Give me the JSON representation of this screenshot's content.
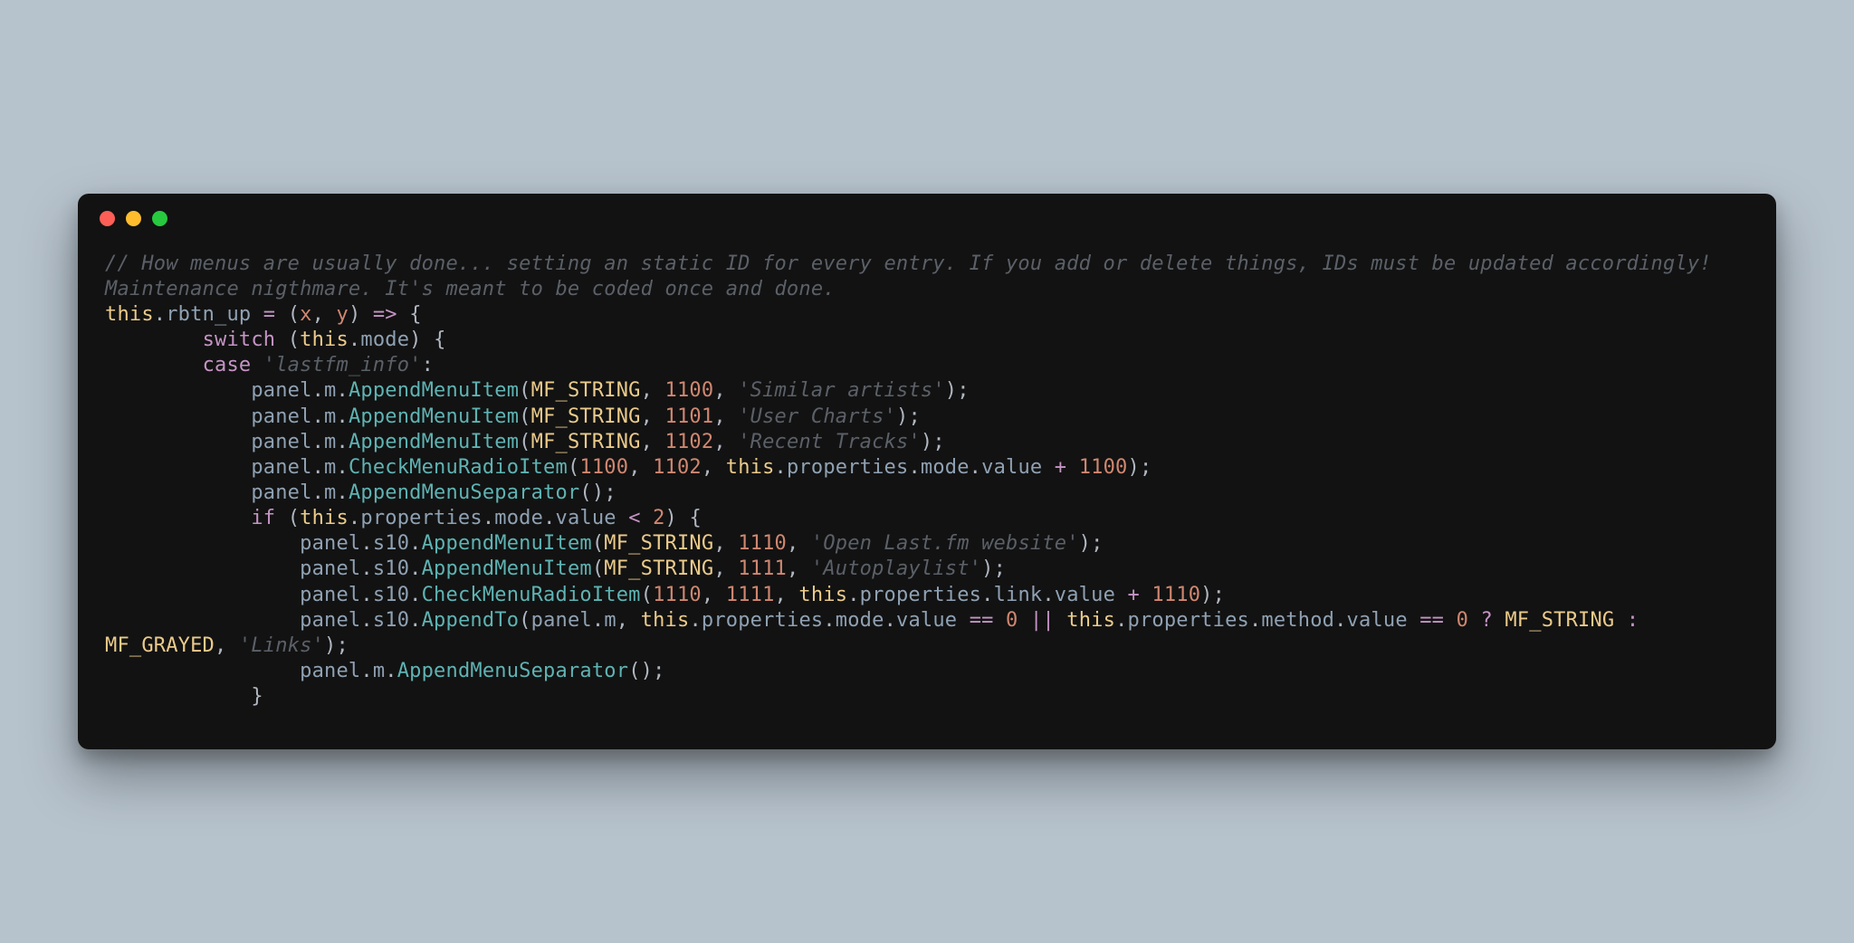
{
  "window": {
    "traffic": {
      "red": "close",
      "yellow": "minimize",
      "green": "zoom"
    }
  },
  "code": {
    "comment": "// How menus are usually done... setting an static ID for every entry. If you add or delete things, IDs must be updated accordingly! Maintenance nigthmare. It's meant to be coded once and done.",
    "l2": {
      "this": "this",
      "dot1": ".",
      "rbtn": "rbtn_up",
      "eq": " = ",
      "lp": "(",
      "x": "x",
      "c": ", ",
      "y": "y",
      "rp": ")",
      "arrow": " => ",
      "lb": "{"
    },
    "l3": {
      "ind": "        ",
      "switch": "switch",
      "sp": " ",
      "lp": "(",
      "this": "this",
      "dot": ".",
      "mode": "mode",
      "rp": ")",
      "sp2": " ",
      "lb": "{"
    },
    "l4": {
      "ind": "        ",
      "case": "case",
      "sp": " ",
      "str": "'lastfm_info'",
      "colon": ":"
    },
    "l5": {
      "ind": "            ",
      "panel": "panel",
      "d1": ".",
      "m": "m",
      "d2": ".",
      "fn": "AppendMenuItem",
      "lp": "(",
      "mf": "MF_STRING",
      "c1": ", ",
      "n": "1100",
      "c2": ", ",
      "s": "'Similar artists'",
      "rp": ")",
      "sc": ";"
    },
    "l6": {
      "ind": "            ",
      "panel": "panel",
      "d1": ".",
      "m": "m",
      "d2": ".",
      "fn": "AppendMenuItem",
      "lp": "(",
      "mf": "MF_STRING",
      "c1": ", ",
      "n": "1101",
      "c2": ", ",
      "s": "'User Charts'",
      "rp": ")",
      "sc": ";"
    },
    "l7": {
      "ind": "            ",
      "panel": "panel",
      "d1": ".",
      "m": "m",
      "d2": ".",
      "fn": "AppendMenuItem",
      "lp": "(",
      "mf": "MF_STRING",
      "c1": ", ",
      "n": "1102",
      "c2": ", ",
      "s": "'Recent Tracks'",
      "rp": ")",
      "sc": ";"
    },
    "l8": {
      "ind": "            ",
      "panel": "panel",
      "d1": ".",
      "m": "m",
      "d2": ".",
      "fn": "CheckMenuRadioItem",
      "lp": "(",
      "n1": "1100",
      "c1": ", ",
      "n2": "1102",
      "c2": ", ",
      "this": "this",
      "d3": ".",
      "props": "properties",
      "d4": ".",
      "mode": "mode",
      "d5": ".",
      "val": "value",
      "plus": " + ",
      "n3": "1100",
      "rp": ")",
      "sc": ";"
    },
    "l9": {
      "ind": "            ",
      "panel": "panel",
      "d1": ".",
      "m": "m",
      "d2": ".",
      "fn": "AppendMenuSeparator",
      "lp": "(",
      "rp": ")",
      "sc": ";"
    },
    "l10": {
      "ind": "            ",
      "if": "if",
      "sp": " ",
      "lp": "(",
      "this": "this",
      "d1": ".",
      "props": "properties",
      "d2": ".",
      "mode": "mode",
      "d3": ".",
      "val": "value",
      "lt": " < ",
      "n": "2",
      "rp": ")",
      "sp2": " ",
      "lb": "{"
    },
    "l11": {
      "ind": "                ",
      "panel": "panel",
      "d1": ".",
      "s10": "s10",
      "d2": ".",
      "fn": "AppendMenuItem",
      "lp": "(",
      "mf": "MF_STRING",
      "c1": ", ",
      "n": "1110",
      "c2": ", ",
      "s": "'Open Last.fm website'",
      "rp": ")",
      "sc": ";"
    },
    "l12": {
      "ind": "                ",
      "panel": "panel",
      "d1": ".",
      "s10": "s10",
      "d2": ".",
      "fn": "AppendMenuItem",
      "lp": "(",
      "mf": "MF_STRING",
      "c1": ", ",
      "n": "1111",
      "c2": ", ",
      "s": "'Autoplaylist'",
      "rp": ")",
      "sc": ";"
    },
    "l13": {
      "ind": "                ",
      "panel": "panel",
      "d1": ".",
      "s10": "s10",
      "d2": ".",
      "fn": "CheckMenuRadioItem",
      "lp": "(",
      "n1": "1110",
      "c1": ", ",
      "n2": "1111",
      "c2": ", ",
      "this": "this",
      "d3": ".",
      "props": "properties",
      "d4": ".",
      "link": "link",
      "d5": ".",
      "val": "value",
      "plus": " + ",
      "n3": "1110",
      "rp": ")",
      "sc": ";"
    },
    "l14a": {
      "ind": "                ",
      "panel": "panel",
      "d1": ".",
      "s10": "s10",
      "d2": ".",
      "fn": "AppendTo",
      "lp": "(",
      "panel2": "panel",
      "d3": ".",
      "m": "m",
      "c1": ", ",
      "this": "this",
      "d4": ".",
      "props": "properties",
      "d5": ".",
      "mode": "mode",
      "d6": ".",
      "val": "value",
      "eq": " == ",
      "z1": "0",
      "or": " || ",
      "this2": "this",
      "d7": ".",
      "props2": "properties",
      "d8": ".",
      "method": "method",
      "d9": ".",
      "val2": "value"
    },
    "l14b": {
      "eq": " == ",
      "z": "0",
      "q": " ? ",
      "mfs": "MF_STRING",
      "col": " : ",
      "mfg": "MF_GRAYED",
      "c": ", ",
      "s": "'Links'",
      "rp": ")",
      "sc": ";"
    },
    "l15": {
      "ind": "                ",
      "panel": "panel",
      "d1": ".",
      "m": "m",
      "d2": ".",
      "fn": "AppendMenuSeparator",
      "lp": "(",
      "rp": ")",
      "sc": ";"
    },
    "l16": {
      "ind": "            ",
      "rb": "}"
    }
  }
}
